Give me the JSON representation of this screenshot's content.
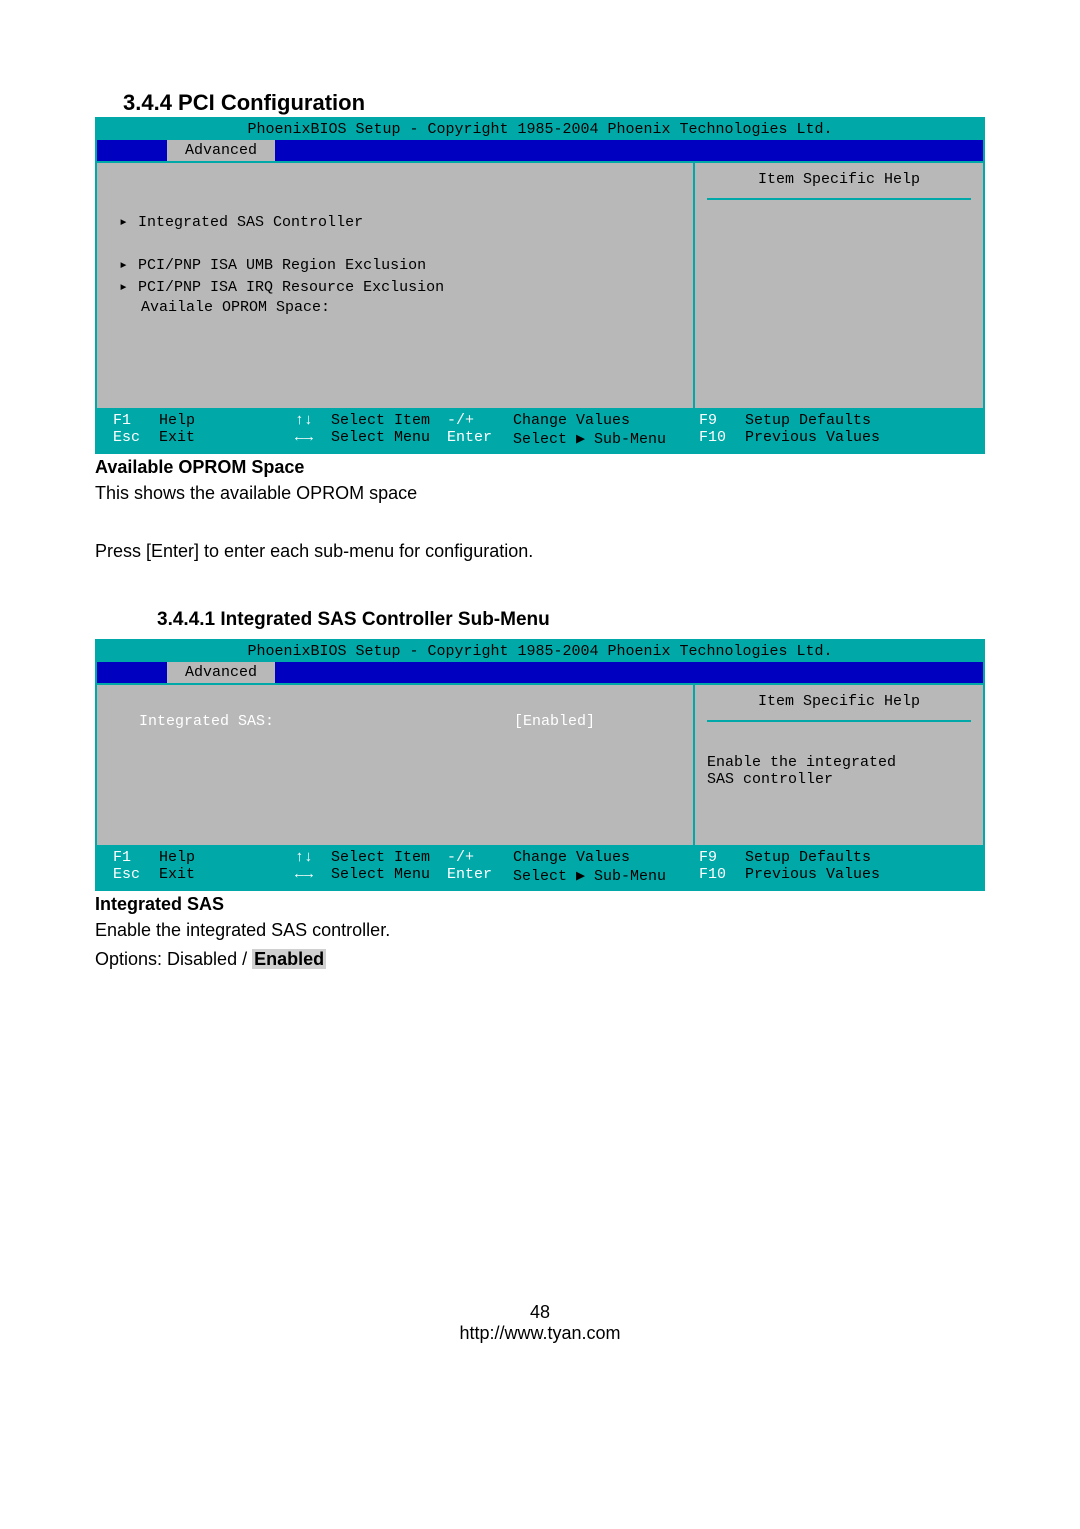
{
  "section_344": "3.4.4  PCI Configuration",
  "bios1": {
    "header": "PhoenixBIOS Setup - Copyright 1985-2004 Phoenix Technologies Ltd.",
    "tab_active": "Advanced",
    "help_title": "Item Specific Help",
    "items": [
      "Integrated SAS Controller",
      "PCI/PNP ISA UMB Region Exclusion",
      "PCI/PNP ISA IRQ Resource Exclusion",
      "Availale OPROM Space:"
    ],
    "footer": {
      "f1": "F1",
      "help": "Help",
      "esc": "Esc",
      "exit": "Exit",
      "updown": "↑↓",
      "select_item": "Select Item",
      "leftright": "←→",
      "select_menu": "Select Menu",
      "plusminus": "-/+",
      "change_values": "Change Values",
      "enter": "Enter",
      "select_submenu": "Select ▶ Sub-Menu",
      "f9": "F9",
      "setup_defaults": "Setup Defaults",
      "f10": "F10",
      "previous_values": "Previous Values"
    }
  },
  "available_oprom_heading": "Available OPROM Space",
  "available_oprom_text": "This shows the available OPROM space",
  "press_enter_text": "Press [Enter] to enter each sub-menu for configuration.",
  "section_3441": "3.4.4.1  Integrated SAS Controller Sub-Menu",
  "bios2": {
    "header": "PhoenixBIOS Setup - Copyright 1985-2004 Phoenix Technologies Ltd.",
    "tab_active": "Advanced",
    "help_title": "Item Specific Help",
    "help_text1": "Enable the integrated",
    "help_text2": "SAS controller",
    "row_label": "Integrated SAS:",
    "row_value": "[Enabled]",
    "footer": {
      "f1": "F1",
      "help": "Help",
      "esc": "Esc",
      "exit": "Exit",
      "updown": "↑↓",
      "select_item": "Select Item",
      "leftright": "←→",
      "select_menu": "Select Menu",
      "plusminus": "-/+",
      "change_values": "Change Values",
      "enter": "Enter",
      "select_submenu": "Select ▶ Sub-Menu",
      "f9": "F9",
      "setup_defaults": "Setup Defaults",
      "f10": "F10",
      "previous_values": "Previous Values"
    }
  },
  "integrated_sas_heading": "Integrated SAS",
  "integrated_sas_text": "Enable the integrated SAS controller.",
  "options_prefix": "Options: Disabled / ",
  "options_default": "Enabled",
  "page_number": "48",
  "page_url": "http://www.tyan.com"
}
